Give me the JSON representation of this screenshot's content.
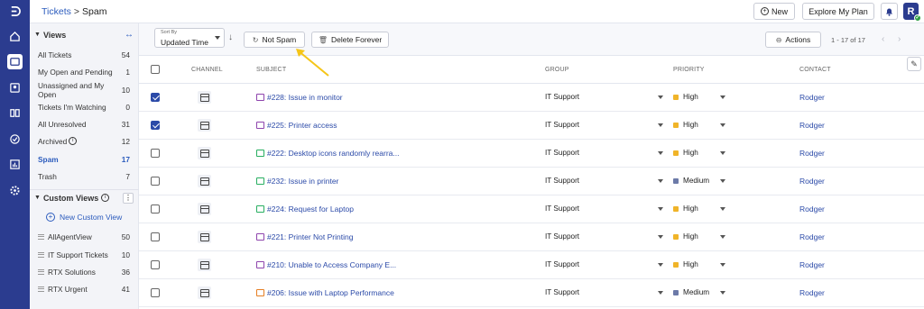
{
  "breadcrumb": {
    "parent": "Tickets",
    "separator": ">",
    "current": "Spam"
  },
  "topbar": {
    "new_label": "New",
    "plan_label": "Explore My Plan",
    "avatar_initial": "R"
  },
  "rail_icons": [
    "logo-icon",
    "home-icon",
    "tickets-icon",
    "contacts-icon",
    "knowledge-base-icon",
    "tasks-icon",
    "reports-icon",
    "settings-icon"
  ],
  "views": {
    "title": "Views",
    "items": [
      {
        "label": "All Tickets",
        "count": "54"
      },
      {
        "label": "My Open and Pending",
        "count": "1"
      },
      {
        "label": "Unassigned and My Open",
        "count": "10"
      },
      {
        "label": "Tickets I'm Watching",
        "count": "0"
      },
      {
        "label": "All Unresolved",
        "count": "31"
      },
      {
        "label": "Archived",
        "count": "12"
      },
      {
        "label": "Spam",
        "count": "17"
      },
      {
        "label": "Trash",
        "count": "7"
      }
    ]
  },
  "custom_views": {
    "title": "Custom Views",
    "new_label": "New Custom View",
    "items": [
      {
        "label": "AllAgentView",
        "count": "50"
      },
      {
        "label": "IT Support Tickets",
        "count": "10"
      },
      {
        "label": "RTX Solutions",
        "count": "36"
      },
      {
        "label": "RTX Urgent",
        "count": "41"
      }
    ]
  },
  "toolbar": {
    "sort_label": "Sort By",
    "sort_value": "Updated Time",
    "not_spam_label": "Not Spam",
    "delete_forever_label": "Delete Forever",
    "actions_label": "Actions",
    "pager_text": "1 - 17 of 17"
  },
  "table": {
    "headers": {
      "channel": "CHANNEL",
      "subject": "SUBJECT",
      "group": "GROUP",
      "priority": "PRIORITY",
      "contact": "CONTACT"
    },
    "rows": [
      {
        "checked": true,
        "subject": "#228: Issue in monitor",
        "type_color": "#8e44ad",
        "group": "IT Support",
        "priority": "High",
        "priority_color": "#f0b429",
        "contact": "Rodger"
      },
      {
        "checked": true,
        "subject": "#225: Printer access",
        "type_color": "#8e44ad",
        "group": "IT Support",
        "priority": "High",
        "priority_color": "#f0b429",
        "contact": "Rodger"
      },
      {
        "checked": false,
        "subject": "#222: Desktop icons randomly rearra...",
        "type_color": "#27ae60",
        "group": "IT Support",
        "priority": "High",
        "priority_color": "#f0b429",
        "contact": "Rodger"
      },
      {
        "checked": false,
        "subject": "#232: Issue in printer",
        "type_color": "#27ae60",
        "group": "IT Support",
        "priority": "Medium",
        "priority_color": "#6c7aa8",
        "contact": "Rodger"
      },
      {
        "checked": false,
        "subject": "#224: Request for Laptop",
        "type_color": "#27ae60",
        "group": "IT Support",
        "priority": "High",
        "priority_color": "#f0b429",
        "contact": "Rodger"
      },
      {
        "checked": false,
        "subject": "#221: Printer Not Printing",
        "type_color": "#8e44ad",
        "group": "IT Support",
        "priority": "High",
        "priority_color": "#f0b429",
        "contact": "Rodger"
      },
      {
        "checked": false,
        "subject": "#210: Unable to Access Company E...",
        "type_color": "#8e44ad",
        "group": "IT Support",
        "priority": "High",
        "priority_color": "#f0b429",
        "contact": "Rodger"
      },
      {
        "checked": false,
        "subject": "#206: Issue with Laptop Performance",
        "type_color": "#e67e22",
        "group": "IT Support",
        "priority": "Medium",
        "priority_color": "#6c7aa8",
        "contact": "Rodger"
      }
    ]
  },
  "colors": {
    "brand": "#2b3c8f",
    "link": "#2b4aa8",
    "annotation": "#f5c518"
  }
}
